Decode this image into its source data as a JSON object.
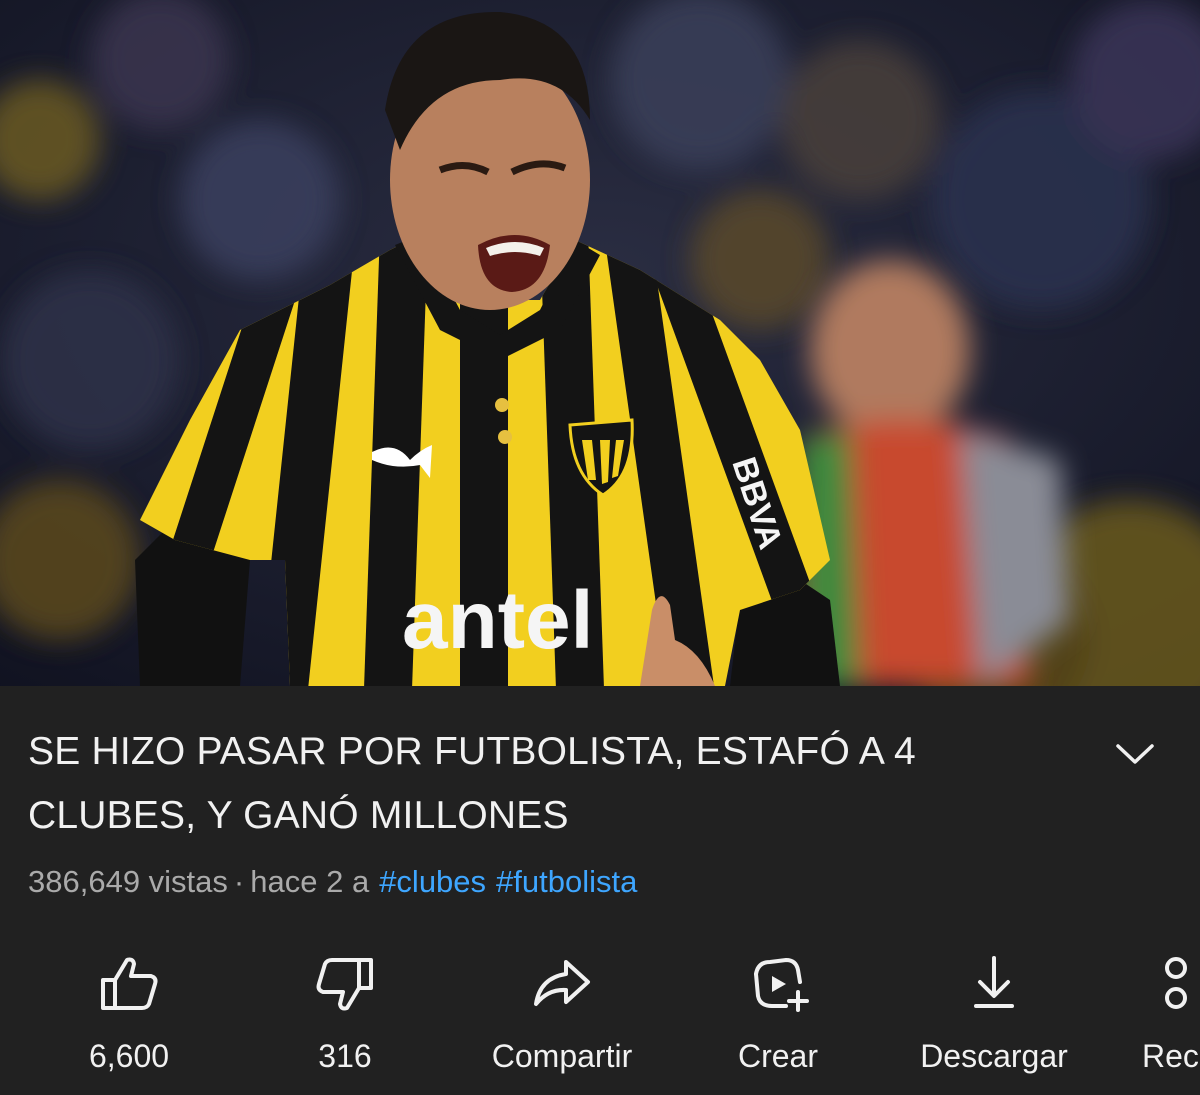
{
  "video": {
    "title": "SE HIZO PASAR POR FUTBOLISTA, ESTAFÓ A 4 CLUBES, Y GANÓ MILLONES",
    "thumbnail_sponsor": "antel",
    "sleeve_sponsor": "BBVA"
  },
  "meta": {
    "views": "386,649 vistas",
    "separator": "·",
    "age": "hace 2 a",
    "hashtags": [
      "#clubes",
      "#futbolista"
    ]
  },
  "actions": {
    "like": {
      "label": "6,600",
      "icon": "thumbs-up-icon"
    },
    "dislike": {
      "label": "316",
      "icon": "thumbs-down-icon"
    },
    "share": {
      "label": "Compartir",
      "icon": "share-arrow-icon"
    },
    "create": {
      "label": "Crear",
      "icon": "create-sparkle-icon"
    },
    "download": {
      "label": "Descargar",
      "icon": "download-icon"
    },
    "save": {
      "label": "Rec",
      "icon": "remix-icon"
    }
  },
  "colors": {
    "background": "#212121",
    "text": "#f1f1f1",
    "secondary_text": "#aaaaaa",
    "hashtag": "#3ea6ff",
    "jersey_yellow": "#f2cf1f",
    "jersey_black": "#141414"
  }
}
